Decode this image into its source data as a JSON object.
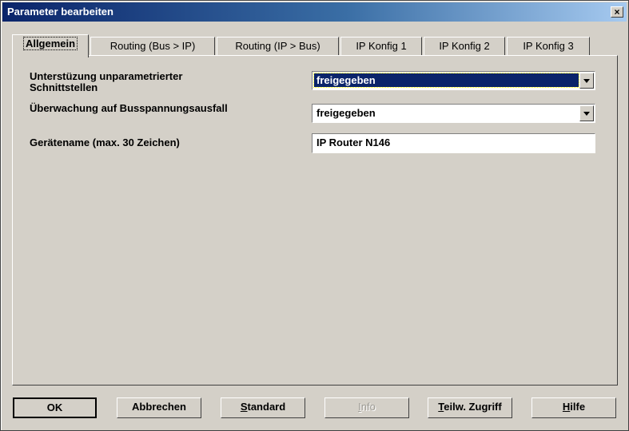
{
  "window": {
    "title": "Parameter bearbeiten",
    "close_label": "×"
  },
  "tabs": [
    {
      "label": "Allgemein",
      "active": true
    },
    {
      "label": "Routing (Bus > IP)",
      "active": false
    },
    {
      "label": "Routing (IP > Bus)",
      "active": false
    },
    {
      "label": "IP Konfig 1",
      "active": false
    },
    {
      "label": "IP Konfig 2",
      "active": false
    },
    {
      "label": "IP Konfig 3",
      "active": false
    }
  ],
  "params": {
    "unparam_label_line1": "Unterstüzung unparametrierter",
    "unparam_label_line2": "Schnittstellen",
    "unparam_value": "freigegeben",
    "bus_voltage_label": "Überwachung auf Busspannungsausfall",
    "bus_voltage_value": "freigegeben",
    "device_name_label": "Gerätename (max. 30 Zeichen)",
    "device_name_value": "IP Router N146"
  },
  "buttons": {
    "ok": "OK",
    "cancel": "Abbrechen",
    "standard_first": "S",
    "standard_rest": "tandard",
    "info_first": "I",
    "info_rest": "nfo",
    "partial_first": "T",
    "partial_rest": "eilw. Zugriff",
    "help_first": "H",
    "help_rest": "ilfe"
  },
  "colors": {
    "title_gradient_start": "#0a246a",
    "selection_highlight": "#0a246a",
    "face": "#d4d0c8"
  },
  "icons": {
    "close": "close-icon",
    "dropdown": "chevron-down-icon"
  }
}
